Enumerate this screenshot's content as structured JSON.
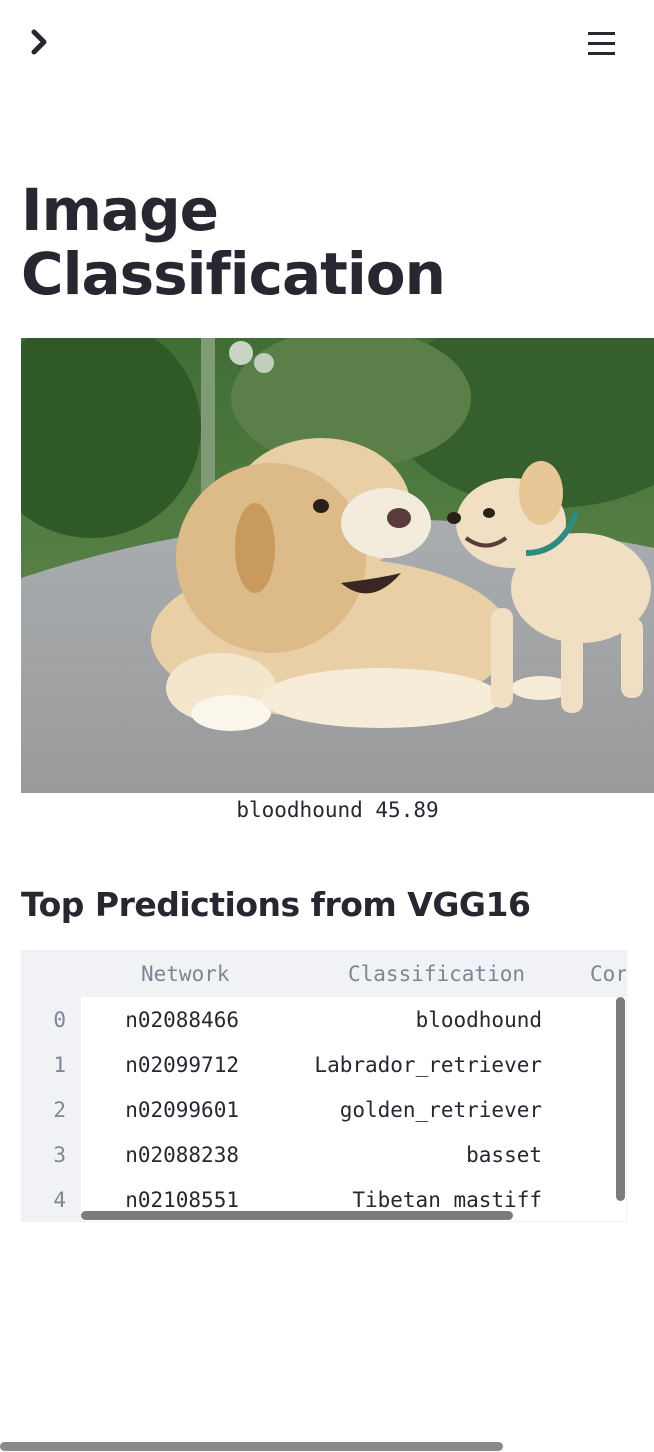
{
  "app": {
    "sidebar_icon": "chevron-right-icon",
    "menu_icon": "hamburger-menu-icon"
  },
  "title": "Image Classification",
  "image": {
    "alt": "Two Labrador dogs, an adult and a puppy, on a paved road",
    "caption": "bloodhound 45.89"
  },
  "section_title": "Top Predictions from VGG16",
  "table": {
    "columns": [
      "Network",
      "Classification",
      "Cor"
    ],
    "rows": [
      {
        "index": "0",
        "network": "n02088466",
        "classification": "bloodhound"
      },
      {
        "index": "1",
        "network": "n02099712",
        "classification": "Labrador_retriever"
      },
      {
        "index": "2",
        "network": "n02099601",
        "classification": "golden_retriever"
      },
      {
        "index": "3",
        "network": "n02088238",
        "classification": "basset"
      },
      {
        "index": "4",
        "network": "n02108551",
        "classification": "Tibetan_mastiff"
      }
    ]
  },
  "colors": {
    "text": "#262730",
    "header_bg": "#f0f2f6",
    "header_text": "#808495",
    "scrollbar": "#7c7c7c"
  }
}
